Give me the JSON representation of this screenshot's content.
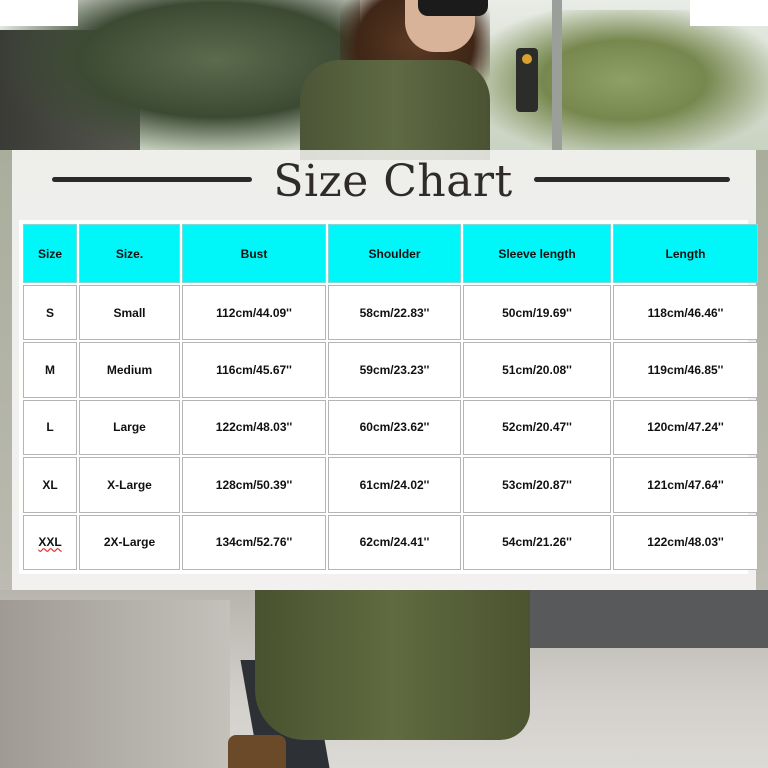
{
  "title": "Size Chart",
  "table": {
    "headers": [
      "Size",
      "Size.",
      "Bust",
      "Shoulder",
      "Sleeve length",
      "Length"
    ],
    "rows": [
      [
        "S",
        "Small",
        "112cm/44.09''",
        "58cm/22.83''",
        "50cm/19.69''",
        "118cm/46.46''"
      ],
      [
        "M",
        "Medium",
        "116cm/45.67''",
        "59cm/23.23''",
        "51cm/20.08''",
        "119cm/46.85''"
      ],
      [
        "L",
        "Large",
        "122cm/48.03''",
        "60cm/23.62''",
        "52cm/20.47''",
        "120cm/47.24''"
      ],
      [
        "XL",
        "X-Large",
        "128cm/50.39''",
        "61cm/24.02''",
        "53cm/20.87''",
        "121cm/47.64''"
      ],
      [
        "XXL",
        "2X-Large",
        "134cm/52.76''",
        "62cm/24.41''",
        "54cm/21.26''",
        "122cm/48.03''"
      ]
    ]
  },
  "colors": {
    "header_bg": "#00f7f9",
    "title_text": "#2e2b29"
  }
}
